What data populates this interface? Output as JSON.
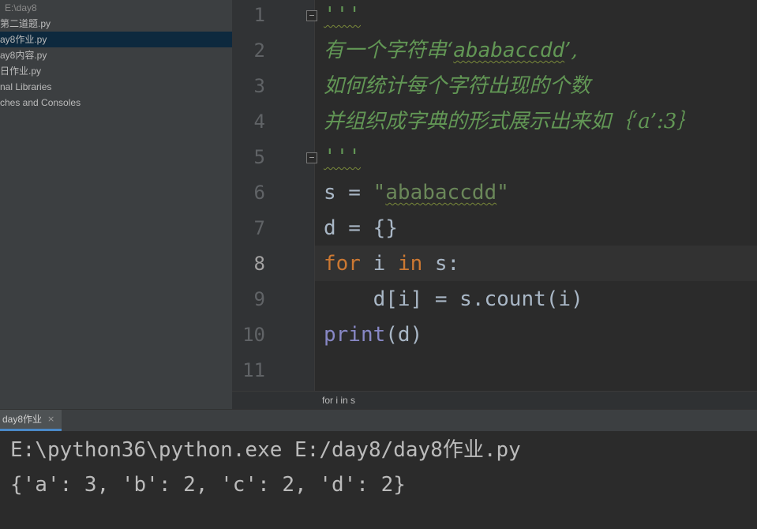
{
  "project_tree": {
    "root": "E:\\day8",
    "items": [
      {
        "label": "第二道题.py",
        "selected": false
      },
      {
        "label": "ay8作业.py",
        "selected": true
      },
      {
        "label": "ay8内容.py",
        "selected": false
      },
      {
        "label": "日作业.py",
        "selected": false
      },
      {
        "label": "nal Libraries",
        "selected": false
      },
      {
        "label": "ches and Consoles",
        "selected": false
      }
    ]
  },
  "editor": {
    "line_numbers": [
      "1",
      "2",
      "3",
      "4",
      "5",
      "6",
      "7",
      "8",
      "9",
      "10",
      "11"
    ],
    "current_line": 8,
    "code": {
      "l1_quote": "'''",
      "l2_a": "有一个字符串‘",
      "l2_b": "ababaccdd",
      "l2_c": "’,",
      "l3": "如何统计每个字符出现的个数",
      "l4": "并组织成字典的形式展示出来如｛‘a’:3｝",
      "l5_quote": "'''",
      "l6_a": "s = ",
      "l6_q1": "\"",
      "l6_str": "ababaccdd",
      "l6_q2": "\"",
      "l7": "d = {}",
      "l8_for": "for",
      "l8_mid": " i ",
      "l8_in": "in",
      "l8_end": " s:",
      "l9": "    d[i] = s.count(i)",
      "l10_print": "print",
      "l10_rest": "(d)"
    },
    "breadcrumb": "for i in s"
  },
  "run_panel": {
    "tab_label": "day8作业",
    "close_glyph": "×",
    "output": [
      "E:\\python36\\python.exe E:/day8/day8作业.py",
      "{'a': 3, 'b': 2, 'c': 2, 'd': 2}"
    ]
  }
}
